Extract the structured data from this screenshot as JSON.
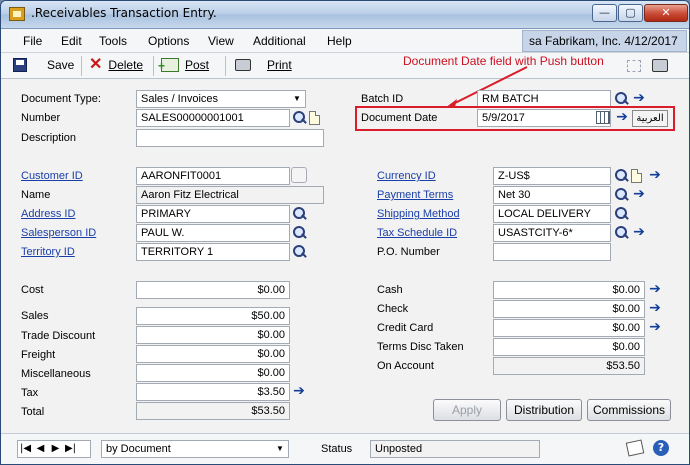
{
  "window": {
    "title": ".Receivables Transaction Entry."
  },
  "titlebar": {
    "minimize": "—",
    "maximize": "▢",
    "close": "✕"
  },
  "menu": {
    "items": [
      "File",
      "Edit",
      "Tools",
      "Options",
      "View",
      "Additional",
      "Help"
    ]
  },
  "user_info": "sa  Fabrikam, Inc.  4/12/2017",
  "toolbar": {
    "save": "Save",
    "delete": "Delete",
    "post": "Post",
    "print": "Print"
  },
  "annotation": "Document Date field with Push button",
  "form": {
    "document_type_label": "Document Type:",
    "document_type_value": "Sales / Invoices",
    "number_label": "Number",
    "number_value": "SALES00000001001",
    "description_label": "Description",
    "description_value": "",
    "batch_id_label": "Batch ID",
    "batch_id_value": "RM BATCH",
    "document_date_label": "Document Date",
    "document_date_value": "5/9/2017",
    "push_button_label": "العربية",
    "customer_id_label": "Customer ID",
    "customer_id_value": "AARONFIT0001",
    "name_label": "Name",
    "name_value": "Aaron Fitz Electrical",
    "address_id_label": "Address ID",
    "address_id_value": "PRIMARY",
    "salesperson_id_label": "Salesperson ID",
    "salesperson_id_value": "PAUL W.",
    "territory_id_label": "Territory ID",
    "territory_id_value": "TERRITORY 1",
    "currency_id_label": "Currency ID",
    "currency_id_value": "Z-US$",
    "payment_terms_label": "Payment Terms",
    "payment_terms_value": "Net 30",
    "shipping_method_label": "Shipping Method",
    "shipping_method_value": "LOCAL DELIVERY",
    "tax_schedule_id_label": "Tax Schedule ID",
    "tax_schedule_id_value": "USASTCITY-6*",
    "po_number_label": "P.O. Number",
    "po_number_value": ""
  },
  "amounts_left": {
    "cost_label": "Cost",
    "cost_value": "$0.00",
    "sales_label": "Sales",
    "sales_value": "$50.00",
    "trade_discount_label": "Trade Discount",
    "trade_discount_value": "$0.00",
    "freight_label": "Freight",
    "freight_value": "$0.00",
    "misc_label": "Miscellaneous",
    "misc_value": "$0.00",
    "tax_label": "Tax",
    "tax_value": "$3.50",
    "total_label": "Total",
    "total_value": "$53.50"
  },
  "amounts_right": {
    "cash_label": "Cash",
    "cash_value": "$0.00",
    "check_label": "Check",
    "check_value": "$0.00",
    "credit_card_label": "Credit Card",
    "credit_card_value": "$0.00",
    "terms_disc_label": "Terms Disc Taken",
    "terms_disc_value": "$0.00",
    "on_account_label": "On Account",
    "on_account_value": "$53.50"
  },
  "buttons": {
    "apply": "Apply",
    "distribution": "Distribution",
    "commissions": "Commissions"
  },
  "statusbar": {
    "sort": "by Document",
    "status_label": "Status",
    "status_value": "Unposted"
  },
  "colors": {
    "annotation": "#d91d2a",
    "link": "#1a3fa8"
  }
}
